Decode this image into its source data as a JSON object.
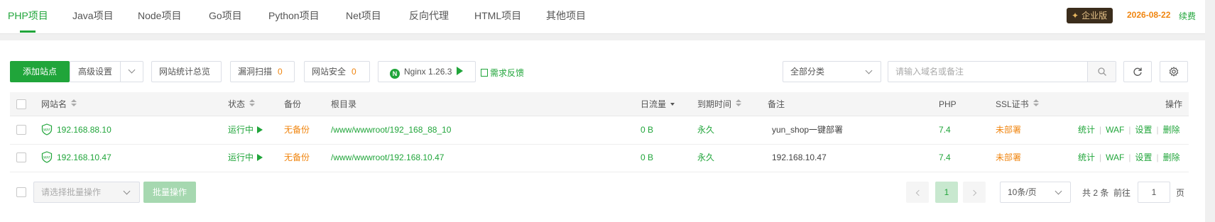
{
  "tabs": [
    {
      "label": "PHP项目",
      "active": true
    },
    {
      "label": "Java项目"
    },
    {
      "label": "Node项目"
    },
    {
      "label": "Go项目"
    },
    {
      "label": "Python项目"
    },
    {
      "label": "Net项目"
    },
    {
      "label": "反向代理"
    },
    {
      "label": "HTML项目"
    },
    {
      "label": "其他项目"
    }
  ],
  "account": {
    "edition": "企业版",
    "expire_date": "2026-08-22",
    "renew": "续费"
  },
  "toolbar": {
    "add_site": "添加站点",
    "advanced": "高级设置",
    "stats_overview": "网站统计总览",
    "vuln_scan": "漏洞扫描",
    "vuln_count": "0",
    "site_security": "网站安全",
    "security_count": "0",
    "nginx": "Nginx 1.26.3",
    "feedback": "需求反馈",
    "category": "全部分类",
    "search_placeholder": "请输入域名或备注"
  },
  "columns": {
    "site_name": "网站名",
    "status": "状态",
    "backup": "备份",
    "root_dir": "根目录",
    "daily_traffic": "日流量",
    "expire_time": "到期时间",
    "remark": "备注",
    "php": "PHP",
    "ssl": "SSL证书",
    "actions": "操作"
  },
  "rows": [
    {
      "name": "192.168.88.10",
      "status": "运行中",
      "backup": "无备份",
      "root": "/www/wwwroot/192_168_88_10",
      "traffic": "0 B",
      "expire": "永久",
      "remark": "yun_shop一键部署",
      "php": "7.4",
      "ssl": "未部署"
    },
    {
      "name": "192.168.10.47",
      "status": "运行中",
      "backup": "无备份",
      "root": "/www/wwwroot/192.168.10.47",
      "traffic": "0 B",
      "expire": "永久",
      "remark": "192.168.10.47",
      "php": "7.4",
      "ssl": "未部署"
    }
  ],
  "row_actions": {
    "stats": "统计",
    "waf": "WAF",
    "settings": "设置",
    "delete": "删除"
  },
  "footer": {
    "batch_placeholder": "请选择批量操作",
    "batch_button": "批量操作",
    "current_page": "1",
    "page_size": "10条/页",
    "total": "共 2 条",
    "goto": "前往",
    "goto_value": "1",
    "page_unit": "页"
  },
  "colors": {
    "accent": "#20a53a",
    "warning": "#f0850f"
  }
}
